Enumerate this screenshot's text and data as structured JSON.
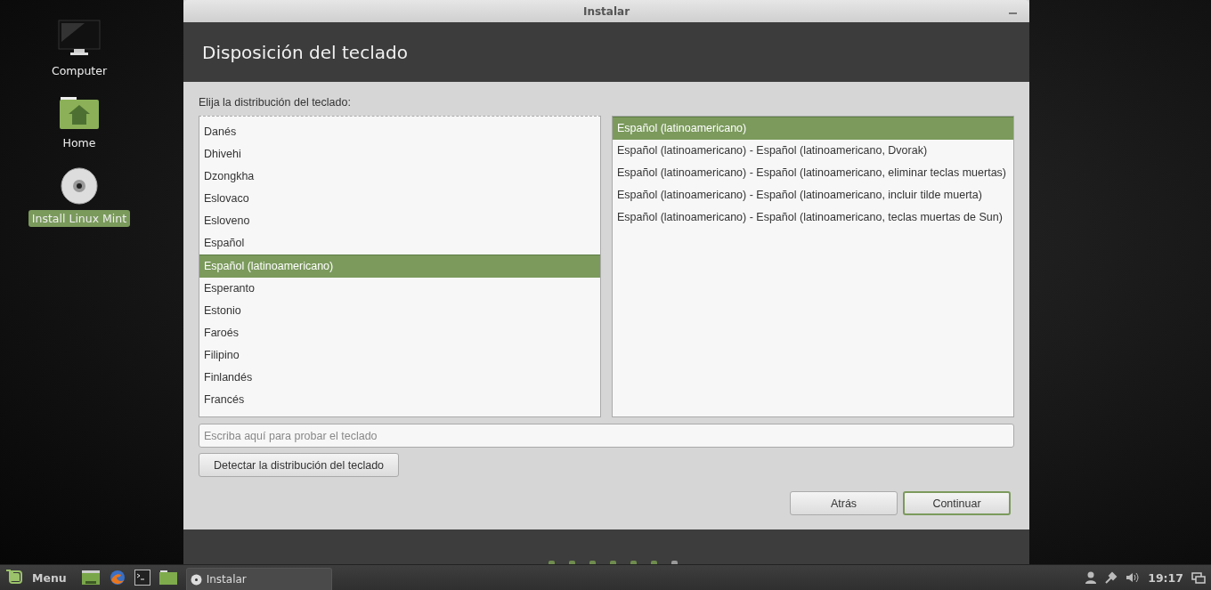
{
  "desktop_icons": [
    {
      "kind": "computer",
      "label": "Computer",
      "selected": false
    },
    {
      "kind": "home",
      "label": "Home",
      "selected": false
    },
    {
      "kind": "disc",
      "label": "Install Linux Mint",
      "selected": true
    }
  ],
  "window": {
    "title": "Instalar",
    "heading": "Disposición del teclado",
    "prompt": "Elija la distribución del teclado:",
    "layouts": [
      {
        "label": "Danés",
        "selected": false
      },
      {
        "label": "Dhivehi",
        "selected": false
      },
      {
        "label": "Dzongkha",
        "selected": false
      },
      {
        "label": "Eslovaco",
        "selected": false
      },
      {
        "label": "Esloveno",
        "selected": false
      },
      {
        "label": "Español",
        "selected": false
      },
      {
        "label": "Español (latinoamericano)",
        "selected": true
      },
      {
        "label": "Esperanto",
        "selected": false
      },
      {
        "label": "Estonio",
        "selected": false
      },
      {
        "label": "Faroés",
        "selected": false
      },
      {
        "label": "Filipino",
        "selected": false
      },
      {
        "label": "Finlandés",
        "selected": false
      },
      {
        "label": "Francés",
        "selected": false
      }
    ],
    "variants": [
      {
        "label": "Español (latinoamericano)",
        "selected": true
      },
      {
        "label": "Español (latinoamericano) - Español (latinoamericano, Dvorak)",
        "selected": false
      },
      {
        "label": "Español (latinoamericano) - Español (latinoamericano, eliminar teclas muertas)",
        "selected": false
      },
      {
        "label": "Español (latinoamericano) - Español (latinoamericano, incluir tilde muerta)",
        "selected": false
      },
      {
        "label": "Español (latinoamericano) - Español (latinoamericano, teclas muertas de Sun)",
        "selected": false
      }
    ],
    "test_field": {
      "placeholder": "Escriba aquí para probar el teclado"
    },
    "detect_button": "Detectar la distribución del teclado",
    "buttons": [
      {
        "label": "Atrás",
        "selected": false
      },
      {
        "label": "Continuar",
        "selected": true
      }
    ],
    "progress_steps": [
      {
        "done": true
      },
      {
        "done": true
      },
      {
        "done": true
      },
      {
        "done": true
      },
      {
        "done": true
      },
      {
        "done": true
      },
      {
        "done": false
      }
    ]
  },
  "taskbar": {
    "menu_label": "Menu",
    "window_buttons": [
      {
        "label": "Instalar",
        "selected": true
      }
    ],
    "clock": "19:17"
  }
}
